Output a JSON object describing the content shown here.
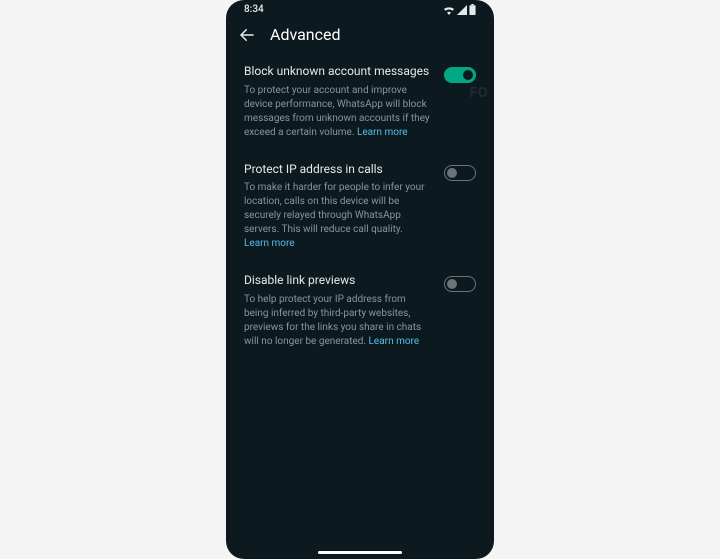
{
  "status_bar": {
    "time": "8:34"
  },
  "app_bar": {
    "title": "Advanced"
  },
  "settings": [
    {
      "title": "Block unknown account messages",
      "body": "To protect your account and improve device performance, WhatsApp will block messages from unknown accounts if they exceed a certain volume. ",
      "learn_more": "Learn more",
      "toggle": true
    },
    {
      "title": "Protect IP address in calls",
      "body": "To make it harder for people to infer your location, calls on this device will be securely relayed through WhatsApp servers. This will reduce call quality. ",
      "learn_more": "Learn more",
      "toggle": false
    },
    {
      "title": "Disable link previews",
      "body": "To help protect your IP address from being inferred by third-party websites, previews for the links you share in chats will no longer be generated. ",
      "learn_more": "Learn more",
      "toggle": false
    }
  ]
}
